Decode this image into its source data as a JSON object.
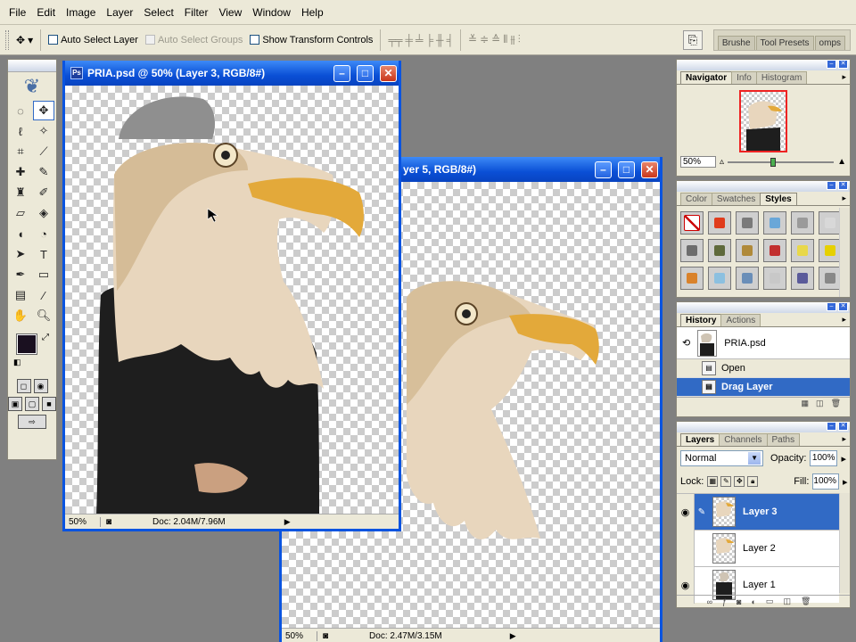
{
  "menu": [
    "File",
    "Edit",
    "Image",
    "Layer",
    "Select",
    "Filter",
    "View",
    "Window",
    "Help"
  ],
  "options": {
    "auto_select_layer": "Auto Select Layer",
    "auto_select_groups": "Auto Select Groups",
    "show_transform_controls": "Show Transform Controls",
    "well_tabs": [
      "Brushe",
      "Tool Presets",
      "omps"
    ]
  },
  "windows": {
    "front": {
      "title": "PRIA.psd @ 50% (Layer 3, RGB/8#)",
      "zoom": "50%",
      "doc": "Doc: 2.04M/7.96M"
    },
    "back": {
      "title": "yer 5, RGB/8#)",
      "zoom": "50%",
      "doc": "Doc: 2.47M/3.15M"
    }
  },
  "navigator": {
    "tabs": [
      "Navigator",
      "Info",
      "Histogram"
    ],
    "zoom": "50%"
  },
  "styles_panel": {
    "tabs": [
      "Color",
      "Swatches",
      "Styles"
    ],
    "swatch_colors": [
      "#ffffff",
      "#e03c1c",
      "#7a7a7a",
      "#6aa7d8",
      "#9a9a9a",
      "#d8d8d8",
      "#6d6d6d",
      "#5f6a3c",
      "#b08a3a",
      "#c23030",
      "#e8d84a",
      "#e6d000",
      "#d9822b",
      "#8cc0e0",
      "#6a8eb8",
      "#c8c8c8",
      "#5a5a9a",
      "#888888"
    ]
  },
  "history": {
    "tabs": [
      "History",
      "Actions"
    ],
    "snapshot": "PRIA.psd",
    "items": [
      {
        "label": "Open",
        "selected": false
      },
      {
        "label": "Drag Layer",
        "selected": true
      }
    ]
  },
  "layers": {
    "tabs": [
      "Layers",
      "Channels",
      "Paths"
    ],
    "blend_mode": "Normal",
    "opacity_label": "Opacity:",
    "opacity": "100%",
    "lock_label": "Lock:",
    "fill_label": "Fill:",
    "fill": "100%",
    "items": [
      {
        "name": "Layer 3",
        "visible": true,
        "selected": true
      },
      {
        "name": "Layer 2",
        "visible": false,
        "selected": false
      },
      {
        "name": "Layer 1",
        "visible": true,
        "selected": false
      }
    ]
  },
  "colors": {
    "xp_blue": "#0a54e0",
    "selection": "#316ac5",
    "foreground": "#1a1020"
  }
}
